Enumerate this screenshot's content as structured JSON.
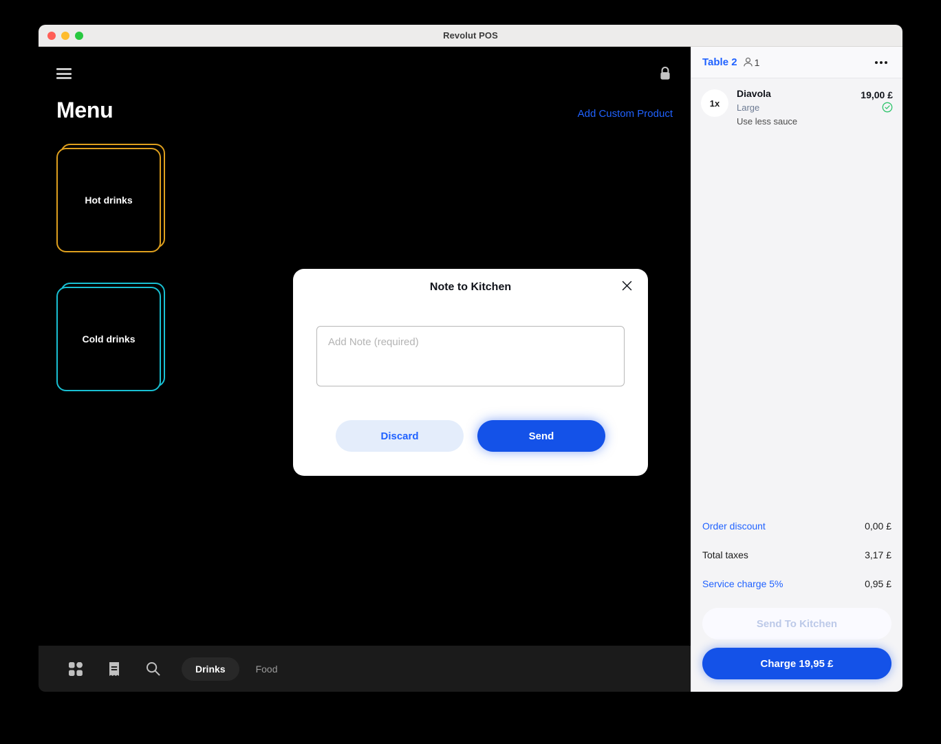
{
  "window": {
    "title": "Revolut POS",
    "traffic_lights": [
      "close",
      "minimize",
      "maximize"
    ]
  },
  "left": {
    "menu_icon": "hamburger-icon",
    "lock_icon": "lock-icon",
    "page_title": "Menu",
    "add_custom_product": "Add Custom Product",
    "categories": [
      {
        "label": "Hot drinks",
        "color": "#dfa01e"
      },
      {
        "label": "Cold drinks",
        "color": "#19c1d4"
      }
    ],
    "toolbar": {
      "icons": [
        "grid-icon",
        "receipt-icon",
        "search-icon"
      ],
      "segments": [
        {
          "label": "Drinks",
          "active": true
        },
        {
          "label": "Food",
          "active": false
        }
      ]
    }
  },
  "order_panel": {
    "table_name": "Table 2",
    "guest_count": "1",
    "guest_icon": "person-icon",
    "more_icon": "more-horizontal-icon",
    "items": [
      {
        "qty": "1x",
        "name": "Diavola",
        "variant": "Large",
        "note": "Use less sauce",
        "price": "19,00 £",
        "status_icon": "check-circle-icon",
        "status_color": "#2ec46b"
      }
    ],
    "totals": [
      {
        "label": "Order discount",
        "value": "0,00 £",
        "link": true
      },
      {
        "label": "Total taxes",
        "value": "3,17 £",
        "link": false
      },
      {
        "label": "Service charge 5%",
        "value": "0,95 £",
        "link": true
      }
    ],
    "send_to_kitchen_label": "Send To Kitchen",
    "charge_label": "Charge 19,95 £"
  },
  "modal": {
    "title": "Note to Kitchen",
    "close_icon": "close-icon",
    "note_placeholder": "Add Note (required)",
    "note_value": "",
    "discard_label": "Discard",
    "send_label": "Send"
  },
  "colors": {
    "accent": "#2062ff",
    "primary_button": "#1452e8",
    "success": "#2ec46b",
    "hot_drinks": "#dfa01e",
    "cold_drinks": "#19c1d4"
  }
}
